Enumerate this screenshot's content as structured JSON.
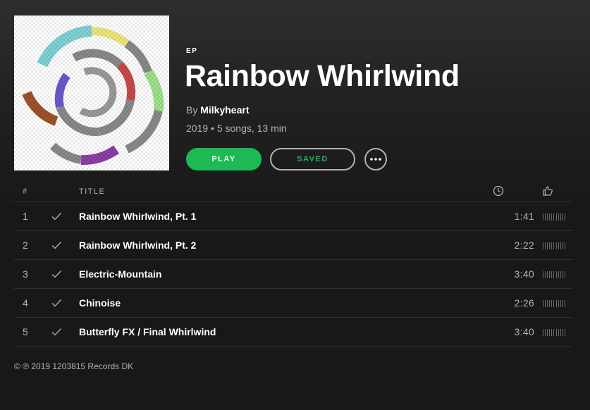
{
  "album": {
    "type_label": "EP",
    "title": "Rainbow Whirlwind",
    "by_prefix": "By",
    "artist": "Milkyheart",
    "meta": "2019 • 5 songs, 13 min",
    "cover_icon": "album-cover-art"
  },
  "actions": {
    "play_label": "PLAY",
    "saved_label": "SAVED",
    "more_icon": "ellipsis-icon"
  },
  "tracklist": {
    "header": {
      "number": "#",
      "title": "TITLE",
      "duration_icon": "clock-icon",
      "popularity_icon": "thumbs-up-icon"
    },
    "tracks": [
      {
        "number": "1",
        "title": "Rainbow Whirlwind, Pt. 1",
        "duration": "1:41",
        "saved": true
      },
      {
        "number": "2",
        "title": "Rainbow Whirlwind, Pt. 2",
        "duration": "2:22",
        "saved": true
      },
      {
        "number": "3",
        "title": "Electric-Mountain",
        "duration": "3:40",
        "saved": true
      },
      {
        "number": "4",
        "title": "Chinoise",
        "duration": "2:26",
        "saved": true
      },
      {
        "number": "5",
        "title": "Butterfly FX / Final Whirlwind",
        "duration": "3:40",
        "saved": true
      }
    ]
  },
  "copyright": "© ℗ 2019 1203815 Records DK",
  "colors": {
    "accent": "#1db954",
    "background": "#181818",
    "text_primary": "#ffffff",
    "text_secondary": "#b3b3b3"
  }
}
